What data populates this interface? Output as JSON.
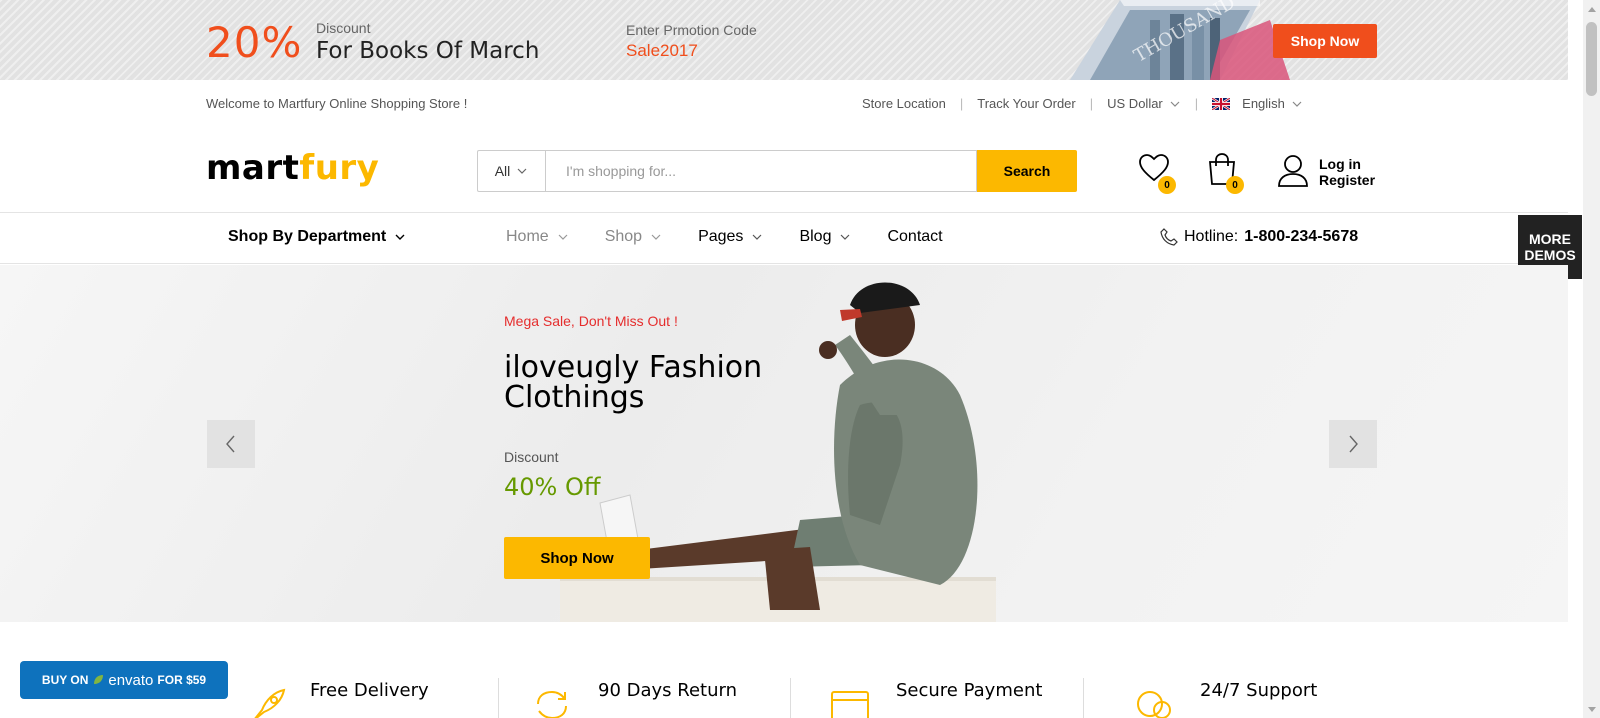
{
  "promo": {
    "percent": "20%",
    "discount_label": "Discount",
    "discount_title": "For Books Of March",
    "code_label": "Enter Prmotion Code",
    "code": "Sale2017",
    "button": "Shop Now"
  },
  "topbar": {
    "welcome": "Welcome to Martfury Online Shopping Store !",
    "links": [
      "Store Location",
      "Track Your Order",
      "US Dollar",
      "English"
    ]
  },
  "header": {
    "logo_part1": "mart",
    "logo_part2": "fury",
    "search_category": "All",
    "search_placeholder": "I'm shopping for...",
    "search_button": "Search",
    "wishlist_count": "0",
    "cart_count": "0",
    "login": "Log in",
    "register": "Register"
  },
  "nav": {
    "department": "Shop By Department",
    "links": [
      "Home",
      "Shop",
      "Pages",
      "Blog",
      "Contact"
    ],
    "hotline_label": "Hotline:",
    "hotline_number": "1-800-234-5678",
    "more_demos": "MORE DEMOS"
  },
  "hero": {
    "tagline": "Mega Sale, Don't Miss Out !",
    "title_line1": "iloveugly Fashion",
    "title_line2": "Clothings",
    "discount_label": "Discount",
    "discount_value": "40% Off",
    "button": "Shop Now"
  },
  "features": [
    "Free Delivery",
    "90 Days Return",
    "Secure Payment",
    "24/7 Support"
  ],
  "envato": {
    "buy_on": "BUY ON",
    "brand": "envato",
    "price": "FOR $59"
  },
  "colors": {
    "accent": "#fcb800",
    "promo_orange": "#f04e1c",
    "hero_red": "#e52d2d",
    "hero_green": "#669900",
    "envato_blue": "#0e72bd"
  }
}
